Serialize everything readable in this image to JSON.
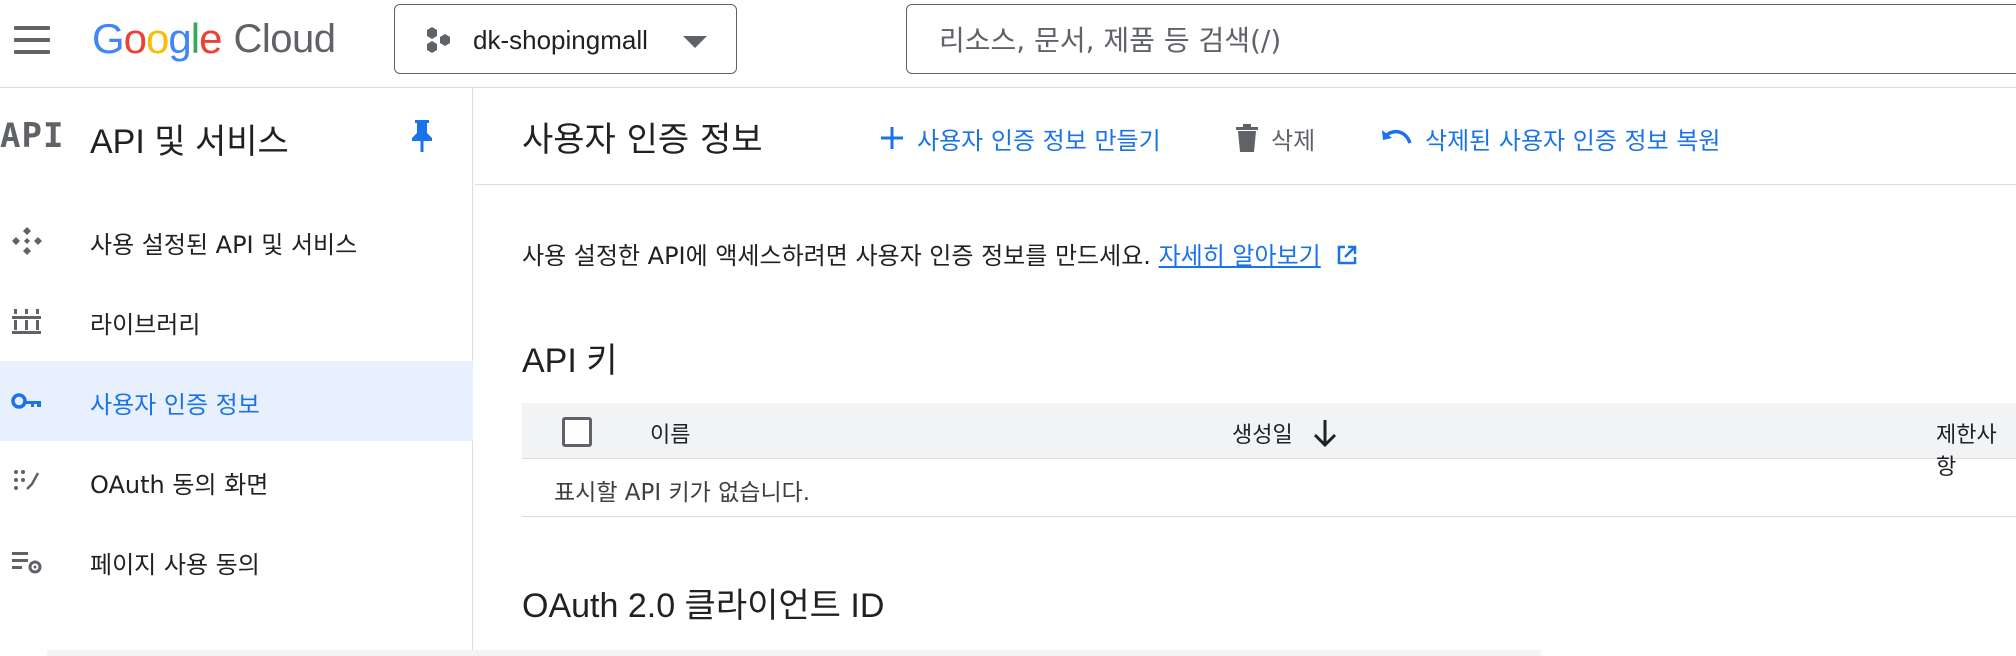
{
  "topbar": {
    "logo": {
      "letters": [
        {
          "ch": "G",
          "color": "#4285F4"
        },
        {
          "ch": "o",
          "color": "#EA4335"
        },
        {
          "ch": "o",
          "color": "#FBBC05"
        },
        {
          "ch": "g",
          "color": "#4285F4"
        },
        {
          "ch": "l",
          "color": "#34A853"
        },
        {
          "ch": "e",
          "color": "#EA4335"
        }
      ],
      "product": "Cloud"
    },
    "project": {
      "name": "dk-shopingmall"
    },
    "search": {
      "placeholder": "리소스, 문서, 제품 등 검색(/)"
    }
  },
  "sidebar": {
    "glyph": "API",
    "title": "API 및 서비스",
    "items": [
      {
        "label": "사용 설정된 API 및 서비스",
        "icon": "enabled-apis-icon"
      },
      {
        "label": "라이브러리",
        "icon": "library-icon"
      },
      {
        "label": "사용자 인증 정보",
        "icon": "key-icon",
        "active": true
      },
      {
        "label": "OAuth 동의 화면",
        "icon": "oauth-consent-icon"
      },
      {
        "label": "페이지 사용 동의",
        "icon": "page-usage-settings-icon"
      }
    ]
  },
  "main": {
    "title": "사용자 인증 정보",
    "actions": {
      "create": "사용자 인증 정보 만들기",
      "delete": "삭제",
      "restore": "삭제된 사용자 인증 정보 복원"
    },
    "intro": {
      "text": "사용 설정한 API에 액세스하려면 사용자 인증 정보를 만드세요.",
      "link": "자세히 알아보기"
    },
    "api_keys": {
      "title": "API 키",
      "columns": {
        "name": "이름",
        "created": "생성일",
        "limits": "제한사항"
      },
      "empty": "표시할 API 키가 없습니다."
    },
    "oauth": {
      "title": "OAuth 2.0 클라이언트 ID"
    }
  },
  "colors": {
    "accent": "#1a73e8",
    "active_bg": "#e8f0fe",
    "divider": "#dadce0",
    "icon_grey": "#5f6368"
  }
}
